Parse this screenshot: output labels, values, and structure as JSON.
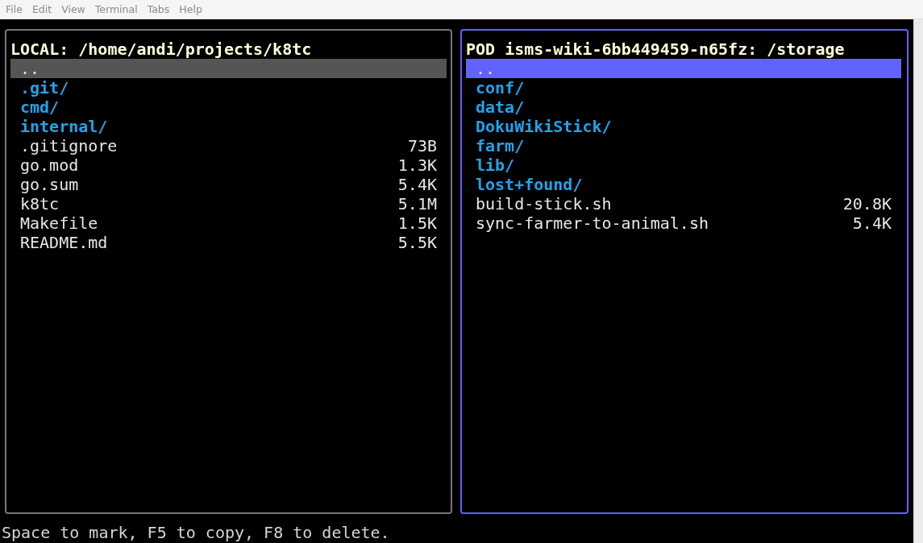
{
  "menu_bar": [
    "File",
    "Edit",
    "View",
    "Terminal",
    "Tabs",
    "Help"
  ],
  "panels": [
    {
      "title": "LOCAL: /home/andi/projects/k8tc",
      "focused": false,
      "entries": [
        {
          "name": "..",
          "kind": "parent",
          "selected": true
        },
        {
          "name": ".git/",
          "kind": "dir",
          "selected": false
        },
        {
          "name": "cmd/",
          "kind": "dir",
          "selected": false
        },
        {
          "name": "internal/",
          "kind": "dir",
          "selected": false
        },
        {
          "name": ".gitignore",
          "kind": "file",
          "size": "73B",
          "selected": false
        },
        {
          "name": "go.mod",
          "kind": "file",
          "size": "1.3K",
          "selected": false
        },
        {
          "name": "go.sum",
          "kind": "file",
          "size": "5.4K",
          "selected": false
        },
        {
          "name": "k8tc",
          "kind": "file",
          "size": "5.1M",
          "selected": false
        },
        {
          "name": "Makefile",
          "kind": "file",
          "size": "1.5K",
          "selected": false
        },
        {
          "name": "README.md",
          "kind": "file",
          "size": "5.5K",
          "selected": false
        }
      ]
    },
    {
      "title": "POD isms-wiki-6bb449459-n65fz: /storage",
      "focused": true,
      "entries": [
        {
          "name": "..",
          "kind": "parent",
          "selected": true
        },
        {
          "name": "conf/",
          "kind": "dir",
          "selected": false
        },
        {
          "name": "data/",
          "kind": "dir",
          "selected": false
        },
        {
          "name": "DokuWikiStick/",
          "kind": "dir",
          "selected": false
        },
        {
          "name": "farm/",
          "kind": "dir",
          "selected": false
        },
        {
          "name": "lib/",
          "kind": "dir",
          "selected": false
        },
        {
          "name": "lost+found/",
          "kind": "dir",
          "selected": false
        },
        {
          "name": "build-stick.sh",
          "kind": "file",
          "size": "20.8K",
          "selected": false
        },
        {
          "name": "sync-farmer-to-animal.sh",
          "kind": "file",
          "size": "5.4K",
          "selected": false
        }
      ]
    }
  ],
  "status_line": "Space to mark, F5 to copy, F8 to delete."
}
